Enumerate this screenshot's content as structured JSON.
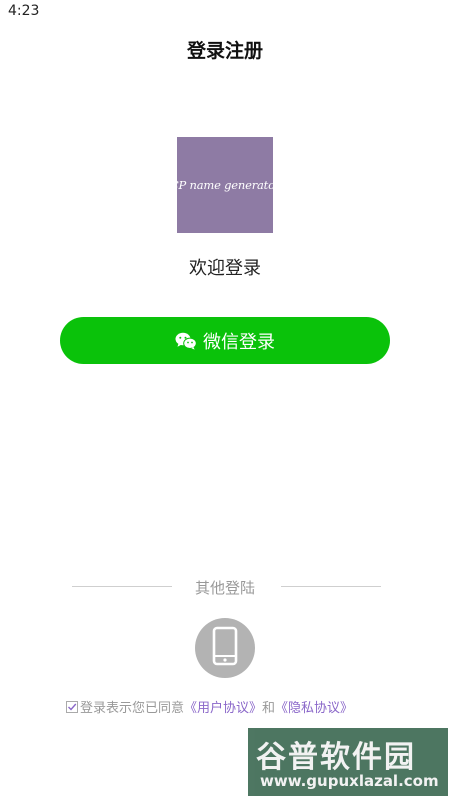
{
  "status_bar": {
    "time": "4:23"
  },
  "header": {
    "title": "登录注册"
  },
  "logo": {
    "text": "CP name generator",
    "bg_color": "#8e7ba4"
  },
  "welcome": {
    "text": "欢迎登录"
  },
  "wechat_login": {
    "label": "微信登录",
    "icon": "wechat-icon",
    "color": "#0ac20a"
  },
  "other_login": {
    "label": "其他登陆",
    "phone_icon": "phone-icon"
  },
  "agreement": {
    "checked": true,
    "prefix": "登录表示您已同意",
    "user_agreement": "《用户协议》",
    "and": "和",
    "privacy_policy": "《隐私协议》",
    "link_color": "#8a67c9"
  },
  "watermark": {
    "title": "谷普软件园",
    "url": "www.gupuxlazal.com"
  }
}
